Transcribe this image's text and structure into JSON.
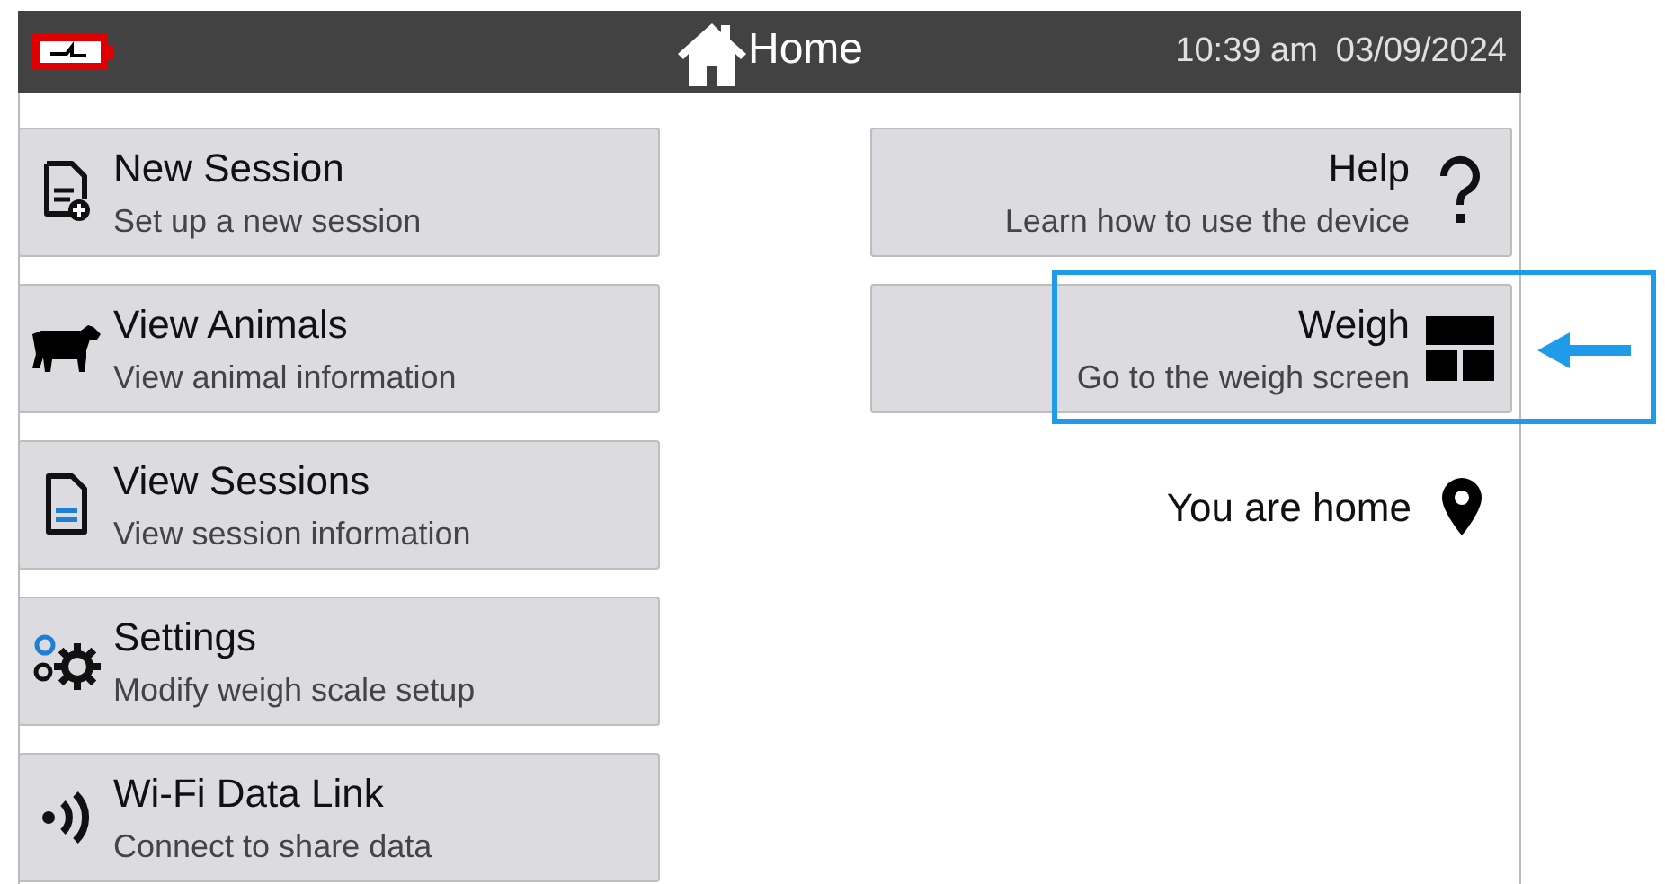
{
  "header": {
    "title": "Home",
    "time": "10:39 am",
    "date": "03/09/2024"
  },
  "left_buttons": [
    {
      "kind": "new-session",
      "title": "New Session",
      "subtitle": "Set up a new session"
    },
    {
      "kind": "animals",
      "title": "View Animals",
      "subtitle": "View animal information"
    },
    {
      "kind": "sessions",
      "title": "View Sessions",
      "subtitle": "View session information"
    },
    {
      "kind": "settings",
      "title": "Settings",
      "subtitle": "Modify weigh scale setup"
    },
    {
      "kind": "wifi",
      "title": "Wi-Fi Data Link",
      "subtitle": "Connect to share data"
    }
  ],
  "right_buttons": [
    {
      "kind": "help",
      "title": "Help",
      "subtitle": "Learn how to use the device",
      "highlighted": false
    },
    {
      "kind": "weigh",
      "title": "Weigh",
      "subtitle": "Go to the weigh screen",
      "highlighted": true
    }
  ],
  "location": {
    "text": "You are home"
  }
}
